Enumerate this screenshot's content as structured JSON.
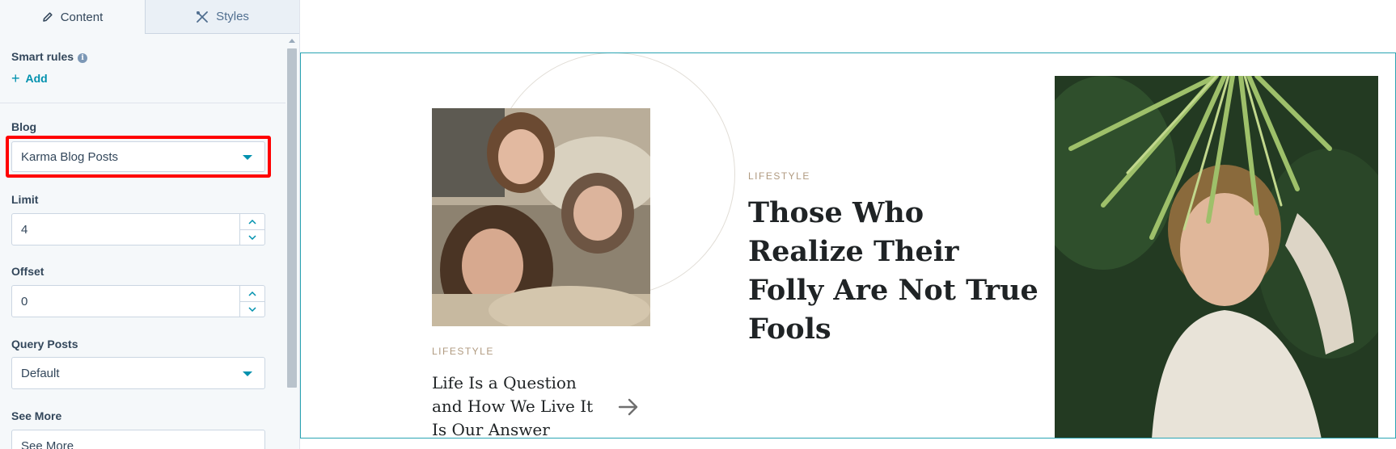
{
  "tabs": [
    {
      "label": "Content",
      "icon": "pencil-icon",
      "active": true
    },
    {
      "label": "Styles",
      "icon": "tools-icon",
      "active": false
    }
  ],
  "smart_rules": {
    "label": "Smart rules",
    "add_label": "Add"
  },
  "blog": {
    "label": "Blog",
    "selected": "Karma Blog Posts"
  },
  "limit": {
    "label": "Limit",
    "value": "4"
  },
  "offset": {
    "label": "Offset",
    "value": "0"
  },
  "query_posts": {
    "label": "Query Posts",
    "selected": "Default"
  },
  "see_more": {
    "label": "See More",
    "value": "See More"
  },
  "preview": {
    "small_post": {
      "category": "LIFESTYLE",
      "title": "Life Is a Question and How We Live It Is Our Answer"
    },
    "featured_post": {
      "category": "LIFESTYLE",
      "title": "Those Who Realize Their Folly Are Not True Fools"
    }
  },
  "colors": {
    "accent": "#0091ae",
    "highlight": "#ff0000",
    "preview_border": "#2aa4b3",
    "category_text": "#b09a80"
  }
}
